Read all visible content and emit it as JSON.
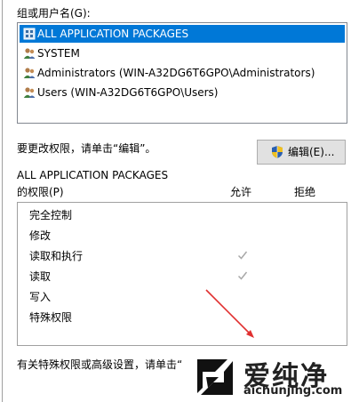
{
  "group": {
    "label": "组或用户名(G):",
    "users": [
      {
        "name": "ALL APPLICATION PACKAGES",
        "icon": "group-packages-icon",
        "selected": true
      },
      {
        "name": "SYSTEM",
        "icon": "users-icon",
        "selected": false
      },
      {
        "name": "Administrators (WIN-A32DG6T6GPO\\Administrators)",
        "icon": "users-icon",
        "selected": false
      },
      {
        "name": "Users (WIN-A32DG6T6GPO\\Users)",
        "icon": "users-icon",
        "selected": false
      }
    ]
  },
  "edit": {
    "hint": "要更改权限，请单击“编辑”。",
    "button_label": "编辑(E)..."
  },
  "permissions": {
    "heading_line1": "ALL APPLICATION PACKAGES",
    "heading_line2": "的权限(P)",
    "allow_label": "允许",
    "deny_label": "拒绝",
    "rows": [
      {
        "name": "完全控制",
        "allow": false,
        "deny": false
      },
      {
        "name": "修改",
        "allow": false,
        "deny": false
      },
      {
        "name": "读取和执行",
        "allow": true,
        "deny": false
      },
      {
        "name": "读取",
        "allow": true,
        "deny": false
      },
      {
        "name": "写入",
        "allow": false,
        "deny": false
      },
      {
        "name": "特殊权限",
        "allow": false,
        "deny": false
      }
    ]
  },
  "footer": {
    "text": "有关特殊权限或高级设置，请单击“"
  },
  "watermark": {
    "title": "爱纯净",
    "url": "aichunjing.com"
  },
  "colors": {
    "selection": "#0078d7",
    "arrow": "#e03030",
    "check": "#a8a8a8"
  }
}
